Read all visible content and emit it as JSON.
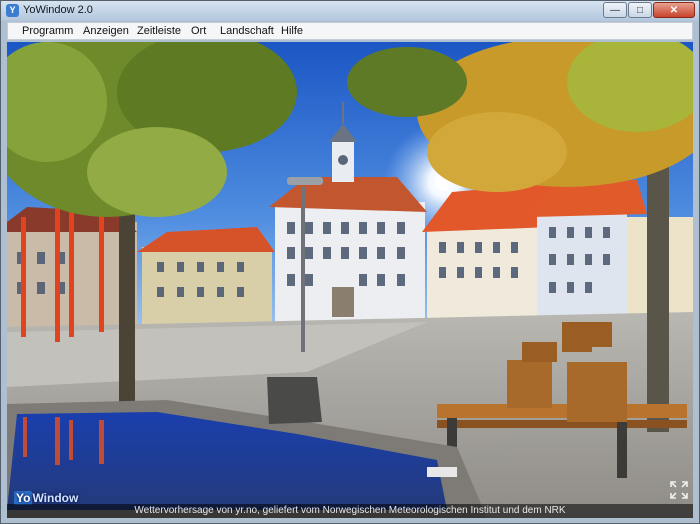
{
  "window": {
    "title": "YoWindow 2.0",
    "app_icon": "yowindow-app-icon",
    "controls": {
      "minimize": "—",
      "maximize": "□",
      "close": "✕"
    }
  },
  "menu": {
    "items": [
      "Programm",
      "Anzeigen",
      "Zeitleiste",
      "Ort",
      "Landschaft",
      "Hilfe"
    ]
  },
  "scene": {
    "brand_prefix": "Yo",
    "brand_suffix": "Window",
    "credit": "Wettervorhersage von yr.no, geliefert vom Norwegischen Meteorologischen Institut und dem NRK",
    "colors": {
      "sky": "#2f6fd6",
      "sun": "#ffffff",
      "cobble": "#a8a6a2",
      "foliage": "#6e8a2a",
      "roof": "#e2582a"
    },
    "icons": [
      "sun-icon",
      "fullscreen-icon"
    ]
  }
}
